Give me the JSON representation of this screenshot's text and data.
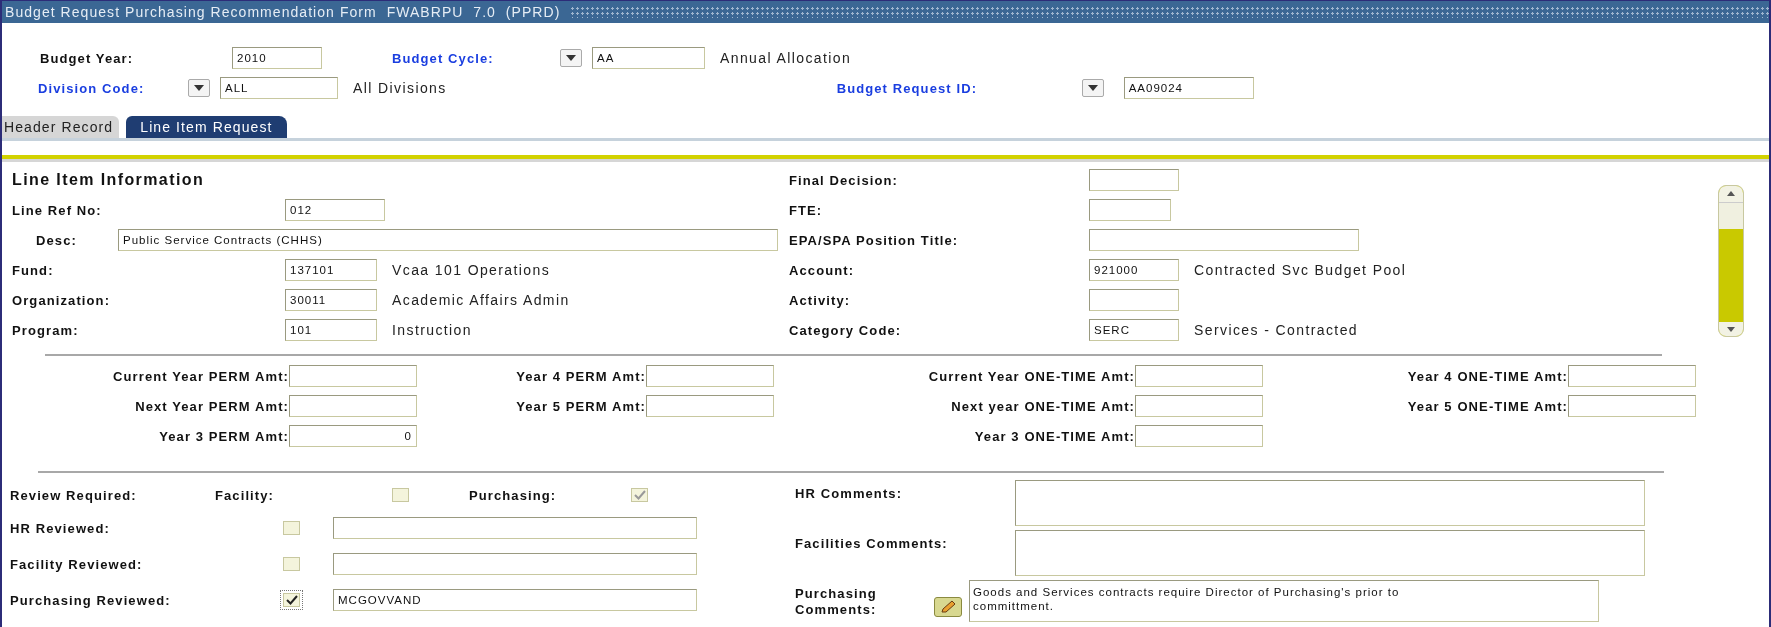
{
  "window": {
    "title": "Budget Request Purchasing Recommendation Form  FWABRPU  7.0  (PPRD)"
  },
  "header_rows": [
    {
      "fields": [
        {
          "label": "Budget Year:",
          "lookup": false,
          "value": "2010"
        },
        {
          "label": "Budget Cycle:",
          "lookup": true,
          "value": "AA",
          "description": "Annual Allocation"
        }
      ]
    },
    {
      "fields": [
        {
          "label": "Division Code:",
          "lookup": true,
          "value": "ALL",
          "description": "All Divisions"
        },
        {
          "label": "Budget Request ID:",
          "lookup": true,
          "value": "AA09024"
        }
      ]
    }
  ],
  "tabs": [
    {
      "label": "Header Record",
      "selected": false
    },
    {
      "label": "Line Item Request",
      "selected": true
    }
  ],
  "line_item": {
    "heading": "Line Item Information",
    "left_fields": [
      {
        "kind": "short",
        "label": "Line Ref No:",
        "value": "012"
      },
      {
        "kind": "wide",
        "label": "Desc:",
        "value": "Public Service Contracts (CHHS)"
      },
      {
        "kind": "short",
        "label": "Fund:",
        "value": "137101",
        "description": "Vcaa 101 Operations"
      },
      {
        "kind": "short",
        "label": "Organization:",
        "value": "30011",
        "description": "Academic Affairs Admin"
      },
      {
        "kind": "short",
        "label": "Program:",
        "value": "101",
        "description": "Instruction"
      }
    ],
    "right_fields": [
      {
        "kind": "short",
        "label": "Final Decision:"
      },
      {
        "kind": "short",
        "label": "FTE:"
      },
      {
        "kind": "wide",
        "label": "EPA/SPA Position Title:"
      },
      {
        "kind": "short",
        "label": "Account:",
        "value": "921000",
        "description": "Contracted Svc Budget Pool"
      },
      {
        "kind": "short",
        "label": "Activity:"
      },
      {
        "kind": "short",
        "label": "Category Code:",
        "value": "SERC",
        "description": "Services - Contracted"
      }
    ]
  },
  "amount_columns": [
    {
      "fields": [
        {
          "label": "Current Year PERM Amt:"
        },
        {
          "label": "Next Year PERM Amt:"
        },
        {
          "label": "Year 3 PERM Amt:",
          "value": "0"
        }
      ]
    },
    {
      "fields": [
        {
          "label": "Year 4 PERM Amt:"
        },
        {
          "label": "Year 5 PERM Amt:"
        }
      ]
    },
    {
      "fields": [
        {
          "label": "Current Year ONE-TIME Amt:"
        },
        {
          "label": "Next year ONE-TIME Amt:"
        },
        {
          "label": "Year 3 ONE-TIME Amt:"
        }
      ]
    },
    {
      "fields": [
        {
          "label": "Year 4 ONE-TIME Amt:"
        },
        {
          "label": "Year 5 ONE-TIME Amt:"
        }
      ]
    }
  ],
  "review_required": {
    "label": "Review Required:",
    "options": [
      {
        "label": "Facility:",
        "checked": false
      },
      {
        "label": "Purchasing:",
        "checked": true
      }
    ]
  },
  "reviews": [
    {
      "label": "HR Reviewed:",
      "checked": false
    },
    {
      "label": "Facility Reviewed:",
      "checked": false
    },
    {
      "label": "Purchasing Reviewed:",
      "checked": true,
      "value": "MCGOVVAND"
    }
  ],
  "comments": [
    {
      "label": "HR Comments:",
      "editable_icon": false
    },
    {
      "label": "Facilities Comments:",
      "editable_icon": false
    },
    {
      "label": "Purchasing Comments:",
      "editable_icon": true,
      "value": "Goods and Services contracts require Director of Purchasing's prior to committment."
    }
  ]
}
